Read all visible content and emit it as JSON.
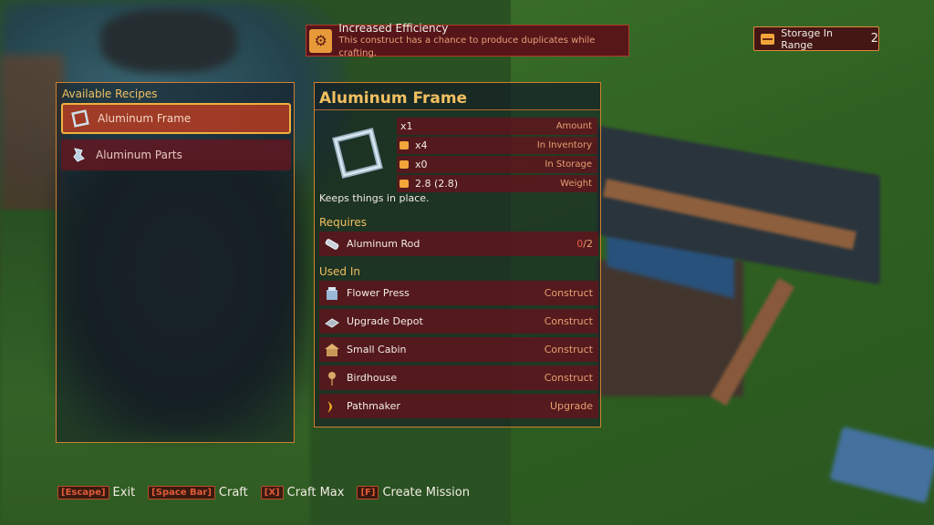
{
  "notification": {
    "title": "Increased Efficiency",
    "description": "This construct has a chance to produce duplicates while crafting.",
    "icon": "gear-icon"
  },
  "storage": {
    "label": "Storage In Range",
    "count": "2",
    "icon": "chest-icon"
  },
  "recipes": {
    "title": "Available Recipes",
    "items": [
      {
        "label": "Aluminum Frame",
        "icon": "frame-icon",
        "selected": true
      },
      {
        "label": "Aluminum Parts",
        "icon": "parts-icon",
        "selected": false
      }
    ]
  },
  "detail": {
    "title": "Aluminum Frame",
    "stats": [
      {
        "value": "x1",
        "key": "Amount",
        "icon": ""
      },
      {
        "value": "x4",
        "key": "In Inventory",
        "icon": "inventory-icon"
      },
      {
        "value": "x0",
        "key": "In Storage",
        "icon": "storage-icon"
      },
      {
        "value": "2.8 (2.8)",
        "key": "Weight",
        "icon": "weight-icon"
      }
    ],
    "description": "Keeps things in place.",
    "requires": {
      "title": "Requires",
      "items": [
        {
          "name": "Aluminum Rod",
          "have": "0",
          "need": "/2",
          "icon": "rod-icon"
        }
      ]
    },
    "used_in": {
      "title": "Used In",
      "items": [
        {
          "name": "Flower Press",
          "type": "Construct",
          "icon": "press-icon"
        },
        {
          "name": "Upgrade Depot",
          "type": "Construct",
          "icon": "depot-icon"
        },
        {
          "name": "Small Cabin",
          "type": "Construct",
          "icon": "cabin-icon"
        },
        {
          "name": "Birdhouse",
          "type": "Construct",
          "icon": "birdhouse-icon"
        },
        {
          "name": "Pathmaker",
          "type": "Upgrade",
          "icon": "pathmaker-icon"
        }
      ]
    }
  },
  "hints": [
    {
      "key": "[Escape]",
      "label": "Exit"
    },
    {
      "key": "[Space Bar]",
      "label": "Craft"
    },
    {
      "key": "[X]",
      "label": "Craft Max"
    },
    {
      "key": "[F]",
      "label": "Create Mission"
    }
  ],
  "colors": {
    "accent": "#f0c060",
    "panel_border": "#d0802e",
    "row_bg": "#60141c"
  }
}
